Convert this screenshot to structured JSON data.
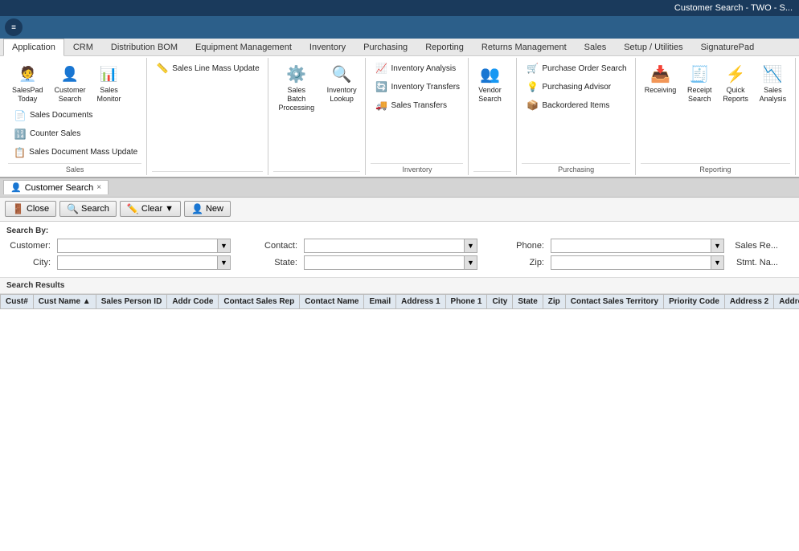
{
  "topbar": {
    "title": "Customer Search - TWO - S..."
  },
  "ribbon_tabs": [
    {
      "label": "Application",
      "active": true
    },
    {
      "label": "CRM",
      "active": false
    },
    {
      "label": "Distribution BOM",
      "active": false
    },
    {
      "label": "Equipment Management",
      "active": false
    },
    {
      "label": "Inventory",
      "active": false
    },
    {
      "label": "Purchasing",
      "active": false
    },
    {
      "label": "Reporting",
      "active": false
    },
    {
      "label": "Returns Management",
      "active": false
    },
    {
      "label": "Sales",
      "active": false
    },
    {
      "label": "Setup / Utilities",
      "active": false
    },
    {
      "label": "SignaturePad",
      "active": false
    }
  ],
  "ribbon_groups": [
    {
      "label": "Sales",
      "large_btns": [
        {
          "icon": "🧑‍💼",
          "label": "SalesPad\nToday"
        },
        {
          "icon": "👤",
          "label": "Customer\nSearch"
        },
        {
          "icon": "📊",
          "label": "Sales\nMonitor"
        }
      ],
      "small_btns": [
        {
          "icon": "📄",
          "label": "Sales Documents"
        },
        {
          "icon": "🔢",
          "label": "Counter Sales"
        },
        {
          "icon": "📋",
          "label": "Sales Document Mass Update"
        }
      ]
    },
    {
      "label": "Sales",
      "large_btns": [],
      "small_btns": [
        {
          "icon": "📏",
          "label": "Sales Line Mass Update"
        }
      ]
    },
    {
      "label": "Sales",
      "large_btns": [
        {
          "icon": "⚙️",
          "label": "Sales Batch\nProcessing"
        },
        {
          "icon": "🔍",
          "label": "Inventory\nLookup"
        }
      ],
      "small_btns": []
    },
    {
      "label": "Inventory",
      "large_btns": [],
      "small_btns": [
        {
          "icon": "📈",
          "label": "Inventory Analysis"
        },
        {
          "icon": "🔄",
          "label": "Inventory Transfers"
        },
        {
          "icon": "🚚",
          "label": "Sales Transfers"
        }
      ]
    },
    {
      "label": "Inventory",
      "large_btns": [
        {
          "icon": "👥",
          "label": "Vendor\nSearch"
        }
      ],
      "small_btns": []
    },
    {
      "label": "Purchasing",
      "large_btns": [],
      "small_btns": [
        {
          "icon": "🛒",
          "label": "Purchase Order Search"
        },
        {
          "icon": "💡",
          "label": "Purchasing Advisor"
        },
        {
          "icon": "📦",
          "label": "Backordered Items"
        }
      ]
    },
    {
      "label": "Purchasing",
      "large_btns": [
        {
          "icon": "📥",
          "label": "Receiving"
        },
        {
          "icon": "🧾",
          "label": "Receipt\nSearch"
        },
        {
          "icon": "⚡",
          "label": "Quick\nReports"
        },
        {
          "icon": "📉",
          "label": "Sales\nAnalysis"
        }
      ],
      "small_btns": []
    },
    {
      "label": "Reporting",
      "large_btns": [],
      "small_btns": []
    }
  ],
  "doc_tab": {
    "icon": "👤",
    "label": "Customer Search",
    "close": "×"
  },
  "action_buttons": [
    {
      "icon": "🚪",
      "label": "Close",
      "has_dropdown": false
    },
    {
      "icon": "🔍",
      "label": "Search",
      "has_dropdown": false
    },
    {
      "icon": "✏️",
      "label": "Clear",
      "has_dropdown": true
    },
    {
      "icon": "👤",
      "label": "New",
      "has_dropdown": false
    }
  ],
  "search_form": {
    "title": "Search By:",
    "fields": [
      {
        "label": "Customer:",
        "value": "",
        "placeholder": ""
      },
      {
        "label": "Contact:",
        "value": "",
        "placeholder": ""
      },
      {
        "label": "Phone:",
        "value": "",
        "placeholder": ""
      },
      {
        "label": "City:",
        "value": "",
        "placeholder": ""
      },
      {
        "label": "State:",
        "value": "",
        "placeholder": ""
      },
      {
        "label": "Zip:",
        "value": "",
        "placeholder": ""
      }
    ],
    "extra_labels": [
      "Sales Re...",
      "Stmt. Na..."
    ]
  },
  "results": {
    "title": "Search Results",
    "columns": [
      {
        "label": "Cust#",
        "sort": ""
      },
      {
        "label": "Cust Name",
        "sort": "▲"
      },
      {
        "label": "Sales Person ID",
        "sort": ""
      },
      {
        "label": "Addr Code",
        "sort": ""
      },
      {
        "label": "Contact Sales Rep",
        "sort": ""
      },
      {
        "label": "Contact Name",
        "sort": ""
      },
      {
        "label": "Email",
        "sort": ""
      },
      {
        "label": "Address 1",
        "sort": ""
      },
      {
        "label": "Phone 1",
        "sort": ""
      },
      {
        "label": "City",
        "sort": ""
      },
      {
        "label": "State",
        "sort": ""
      },
      {
        "label": "Zip",
        "sort": ""
      },
      {
        "label": "Contact Sales Territory",
        "sort": ""
      },
      {
        "label": "Priority Code",
        "sort": ""
      },
      {
        "label": "Address 2",
        "sort": ""
      },
      {
        "label": "Address...",
        "sort": ""
      }
    ],
    "rows": []
  }
}
